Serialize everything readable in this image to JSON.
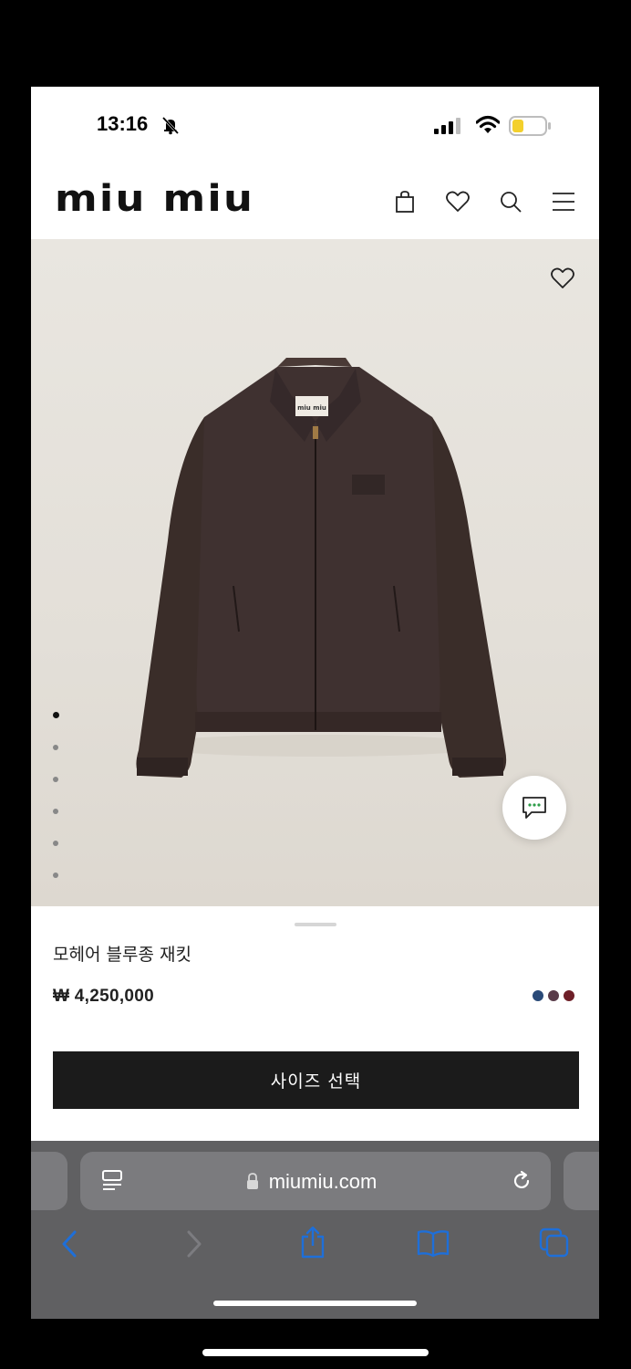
{
  "status_bar": {
    "time": "13:16"
  },
  "header": {
    "logo": "miu miu"
  },
  "product": {
    "name": "모헤어 블루종 재킷",
    "price": "₩ 4,250,000",
    "color_swatches": [
      "#2a4a78",
      "#5a3c4a",
      "#6e1f28"
    ],
    "size_button_label": "사이즈 선택"
  },
  "gallery": {
    "slide_count": 6,
    "active_slide": 1
  },
  "browser": {
    "url": "miumiu.com"
  },
  "colors": {
    "accent": "#1b1b1b",
    "safari_link": "#1e6fd9"
  }
}
